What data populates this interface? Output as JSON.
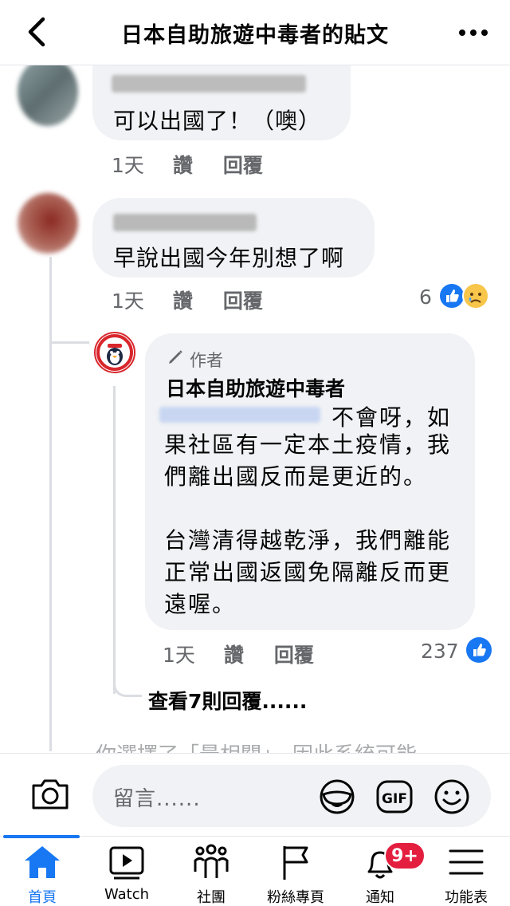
{
  "header": {
    "title": "日本自助旅遊中毒者的貼文",
    "back_icon": "chevron-left-icon",
    "more_icon": "more-horizontal-icon"
  },
  "comments": [
    {
      "text": "可以出國了！（噢）",
      "time": "1天",
      "like_label": "讚",
      "reply_label": "回覆"
    },
    {
      "text": "早說出國今年別想了啊",
      "time": "1天",
      "like_label": "讚",
      "reply_label": "回覆",
      "reaction_count": "6",
      "reactions": [
        "like",
        "sad"
      ],
      "replies": [
        {
          "author_badge": "作者",
          "author_name": "日本自助旅遊中毒者",
          "body_first": "不會呀，如",
          "body_rest": "果社區有一定本土疫情，我\n們離出國反而是更近的。\n\n台灣清得越乾淨，我們離能\n正常出國返國免隔離反而更\n遠喔。",
          "time": "1天",
          "like_label": "讚",
          "reply_label": "回覆",
          "reaction_count": "237",
          "reactions": [
            "like"
          ]
        }
      ],
      "view_more_replies": "查看7則回覆......"
    }
  ],
  "footer_note": "你選擇了「最相關」，因此系統可能",
  "composer": {
    "placeholder": "留言......",
    "icons": [
      "camera-icon",
      "sticker-icon",
      "gif-icon",
      "emoji-icon"
    ]
  },
  "tabs": [
    {
      "label": "首頁",
      "icon": "home-icon",
      "active": true
    },
    {
      "label": "Watch",
      "icon": "watch-icon"
    },
    {
      "label": "社團",
      "icon": "groups-icon"
    },
    {
      "label": "粉絲專頁",
      "icon": "pages-flag-icon"
    },
    {
      "label": "通知",
      "icon": "bell-icon",
      "badge": "9+"
    },
    {
      "label": "功能表",
      "icon": "menu-icon"
    }
  ],
  "colors": {
    "accent": "#1877f2",
    "bubble": "#f0f2f5",
    "secondary_text": "#65676b",
    "badge": "#e41e3f"
  }
}
